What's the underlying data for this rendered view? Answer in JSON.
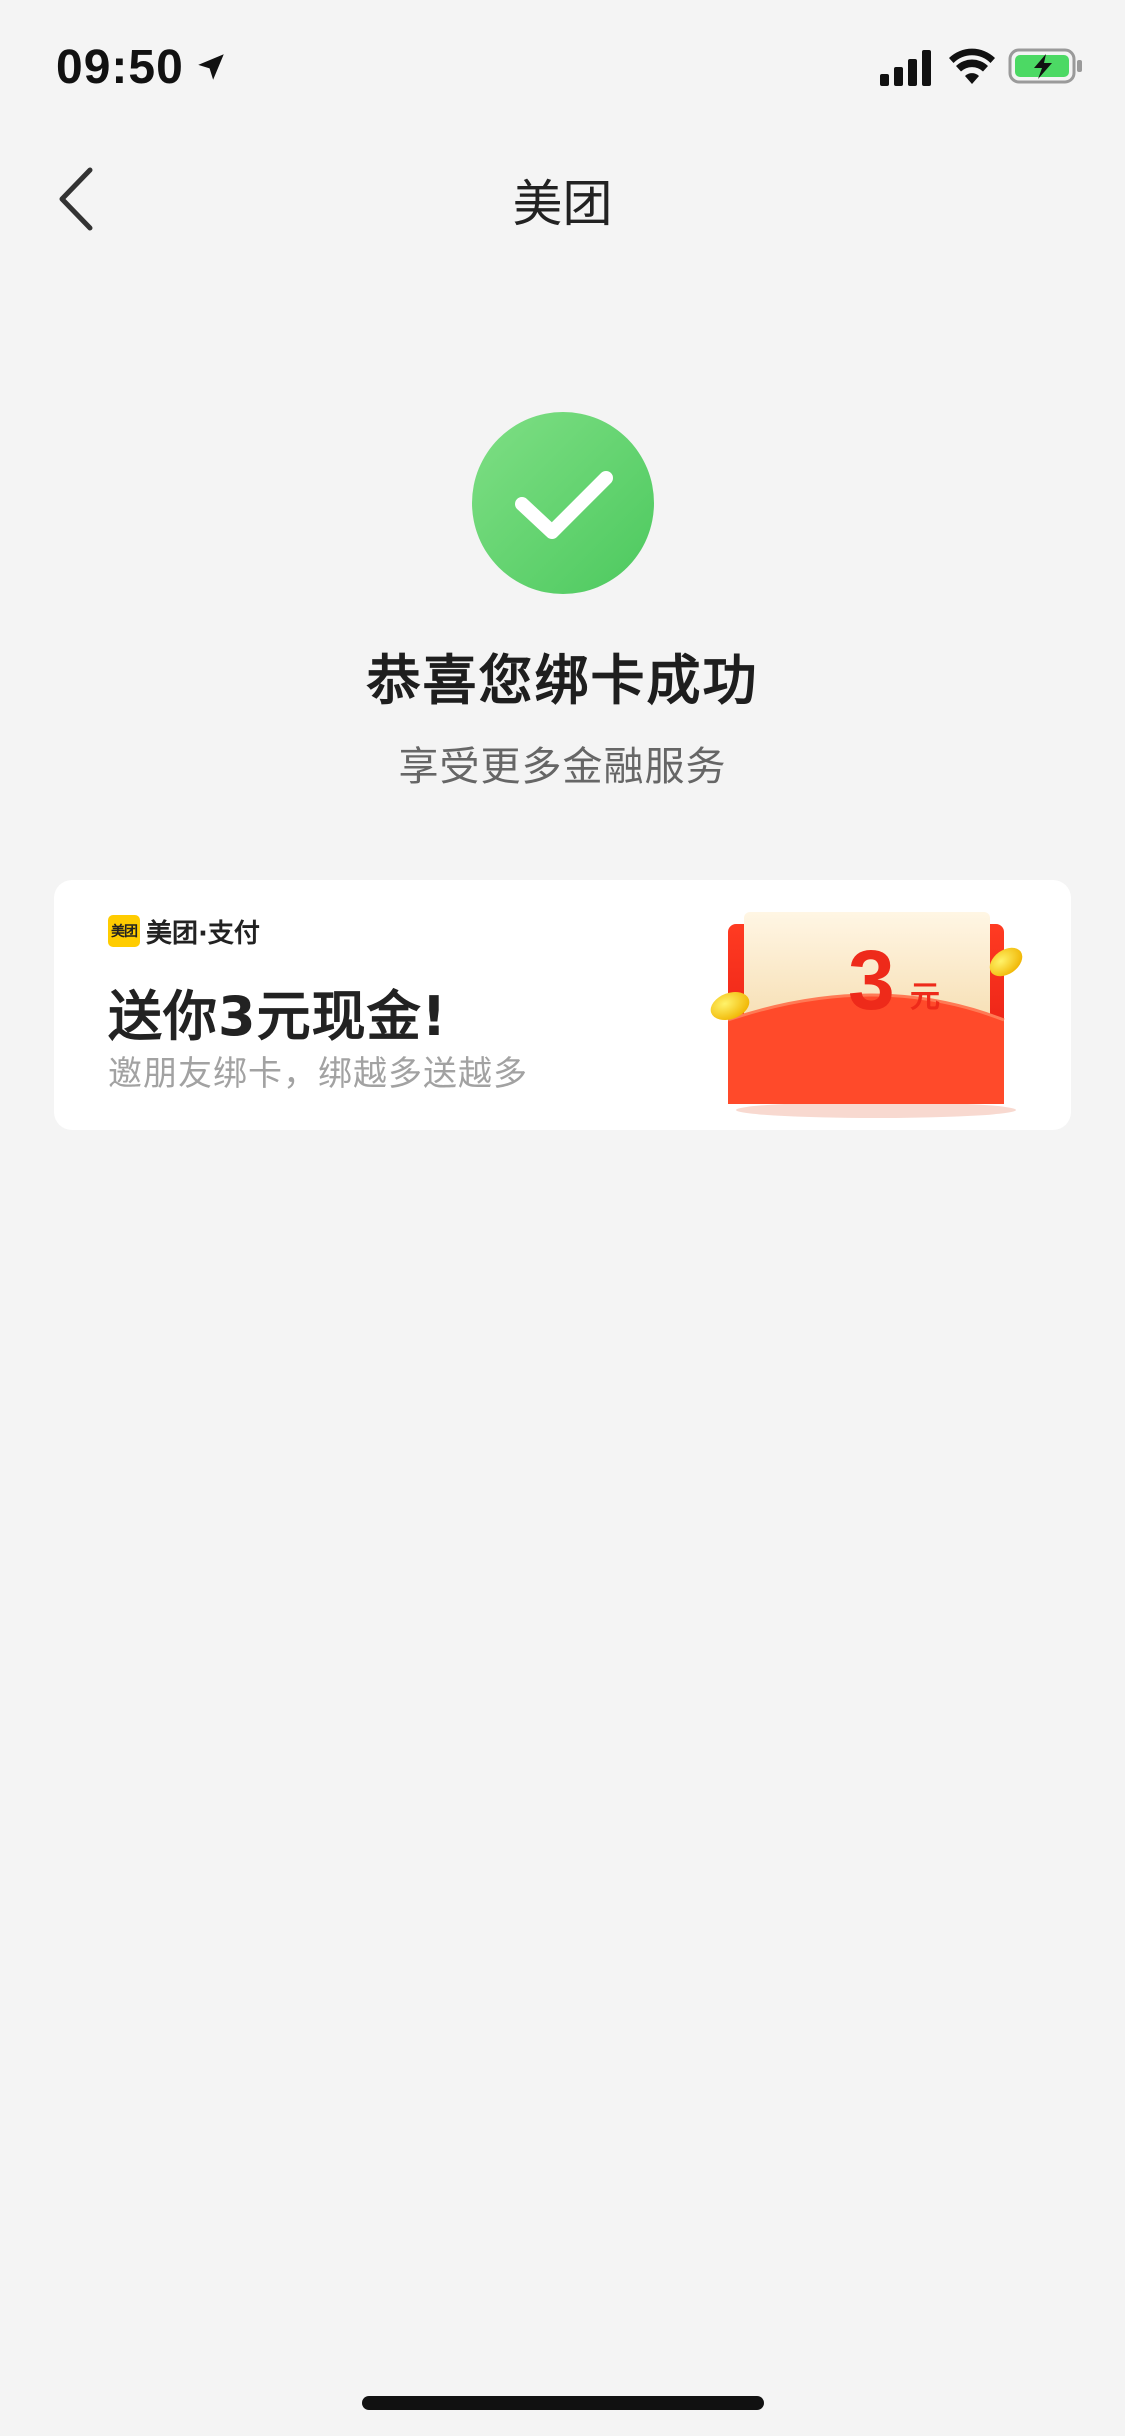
{
  "status_bar": {
    "time": "09:50",
    "icons": [
      "location-arrow-icon",
      "cellular-signal-icon",
      "wifi-icon",
      "battery-charging-icon"
    ]
  },
  "nav": {
    "back_icon": "chevron-left-icon",
    "title": "美团"
  },
  "success": {
    "icon": "check-circle-icon",
    "title": "恭喜您绑卡成功",
    "subtitle": "享受更多金融服务"
  },
  "promo": {
    "brand_logo_text": "美团",
    "brand_text": "美团·支付",
    "title": "送你3元现金!",
    "subtitle": "邀朋友绑卡，绑越多送越多",
    "envelope_amount": "3",
    "envelope_unit": "元"
  },
  "colors": {
    "success_green": "#5bd06a",
    "brand_yellow": "#ffcc00",
    "envelope_red": "#ee2a1a",
    "background": "#f4f4f4"
  }
}
